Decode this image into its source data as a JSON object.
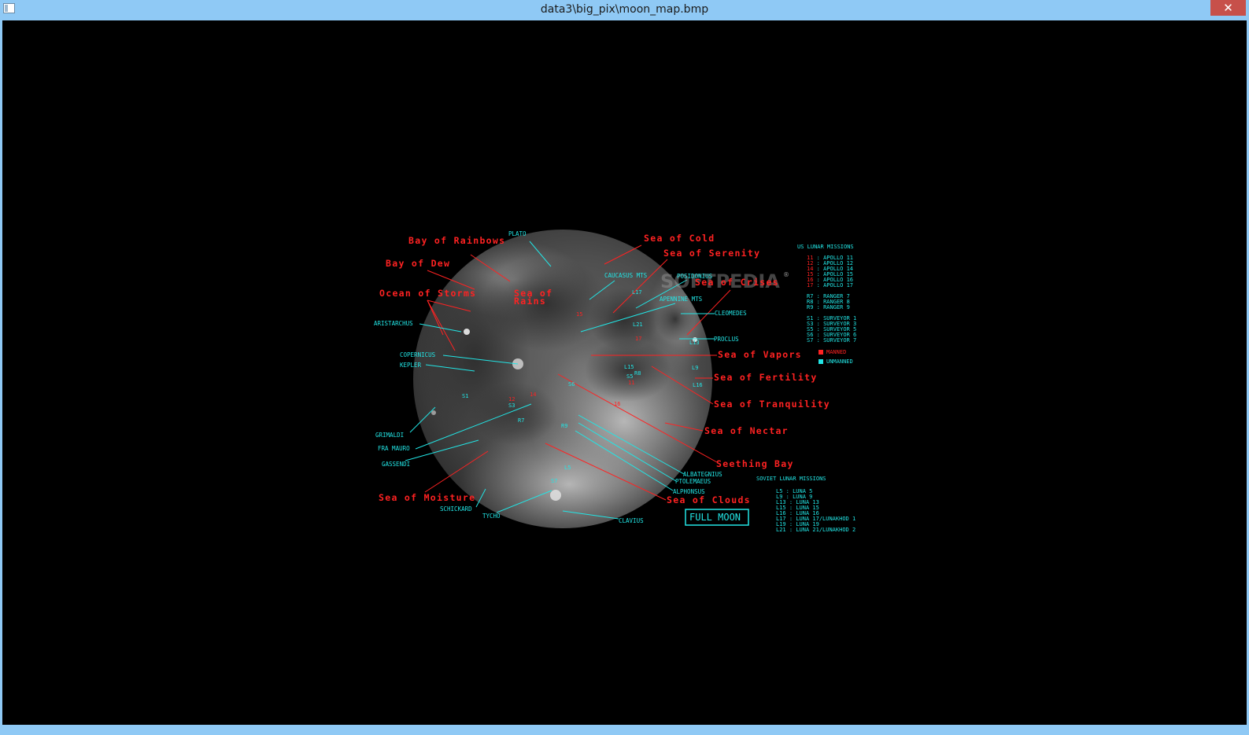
{
  "window": {
    "title": "data3\\big_pix\\moon_map.bmp",
    "close_glyph": "✕"
  },
  "watermark": "SOFTPEDIA",
  "watermark_reg": "®",
  "full_moon_button": "FULL MOON",
  "maria_labels": [
    {
      "id": "bay-of-rainbows",
      "text": "Bay of Rainbows"
    },
    {
      "id": "sea-of-cold",
      "text": "Sea of Cold"
    },
    {
      "id": "sea-of-serenity",
      "text": "Sea of Serenity"
    },
    {
      "id": "bay-of-dew",
      "text": "Bay of Dew"
    },
    {
      "id": "sea-of-crises",
      "text": "Sea of Crises"
    },
    {
      "id": "ocean-of-storms",
      "text": "Ocean of Storms"
    },
    {
      "id": "sea-of-rains-1",
      "text": "Sea of"
    },
    {
      "id": "sea-of-rains-2",
      "text": "Rains"
    },
    {
      "id": "sea-of-vapors",
      "text": "Sea of Vapors"
    },
    {
      "id": "sea-of-fertility",
      "text": "Sea of Fertility"
    },
    {
      "id": "sea-of-tranquility",
      "text": "Sea of Tranquility"
    },
    {
      "id": "sea-of-nectar",
      "text": "Sea of Nectar"
    },
    {
      "id": "seething-bay",
      "text": "Seething Bay"
    },
    {
      "id": "sea-of-moisture",
      "text": "Sea of Moisture"
    },
    {
      "id": "sea-of-clouds",
      "text": "Sea of Clouds"
    }
  ],
  "feature_labels": [
    {
      "id": "plato",
      "text": "PLATO"
    },
    {
      "id": "caucasus-mts",
      "text": "CAUCASUS MTS"
    },
    {
      "id": "posidonius",
      "text": "POSIDONIUS"
    },
    {
      "id": "apennine-mts",
      "text": "APENNINE MTS"
    },
    {
      "id": "cleomedes",
      "text": "CLEOMEDES"
    },
    {
      "id": "aristarchus",
      "text": "ARISTARCHUS"
    },
    {
      "id": "proclus",
      "text": "PROCLUS"
    },
    {
      "id": "copernicus",
      "text": "COPERNICUS"
    },
    {
      "id": "kepler",
      "text": "KEPLER"
    },
    {
      "id": "grimaldi",
      "text": "GRIMALDI"
    },
    {
      "id": "fra-mauro",
      "text": "FRA MAURO"
    },
    {
      "id": "gassendi",
      "text": "GASSENDI"
    },
    {
      "id": "albategnius",
      "text": "ALBATEGNIUS"
    },
    {
      "id": "ptolemaeus",
      "text": "PTOLEMAEUS"
    },
    {
      "id": "alphonsus",
      "text": "ALPHONSUS"
    },
    {
      "id": "schickard",
      "text": "SCHICKARD"
    },
    {
      "id": "tycho",
      "text": "TYCHO"
    },
    {
      "id": "clavius",
      "text": "CLAVIUS"
    }
  ],
  "site_markers": [
    {
      "text": "L17",
      "color": "cyan"
    },
    {
      "text": "15",
      "color": "red"
    },
    {
      "text": "L21",
      "color": "cyan"
    },
    {
      "text": "17",
      "color": "red"
    },
    {
      "text": "L13",
      "color": "cyan"
    },
    {
      "text": "L15",
      "color": "cyan"
    },
    {
      "text": "R8",
      "color": "cyan"
    },
    {
      "text": "L9",
      "color": "cyan"
    },
    {
      "text": "S5",
      "color": "cyan"
    },
    {
      "text": "11",
      "color": "red"
    },
    {
      "text": "L16",
      "color": "cyan"
    },
    {
      "text": "S6",
      "color": "cyan"
    },
    {
      "text": "16",
      "color": "red"
    },
    {
      "text": "S1",
      "color": "cyan"
    },
    {
      "text": "12",
      "color": "red"
    },
    {
      "text": "14",
      "color": "red"
    },
    {
      "text": "S3",
      "color": "cyan"
    },
    {
      "text": "R7",
      "color": "cyan"
    },
    {
      "text": "R9",
      "color": "cyan"
    },
    {
      "text": "L5",
      "color": "cyan"
    },
    {
      "text": "S7",
      "color": "cyan"
    }
  ],
  "us_missions": {
    "title": "US LUNAR MISSIONS",
    "items": [
      {
        "code": "11",
        "sep": " : ",
        "name": "APOLLO 11",
        "code_color": "red"
      },
      {
        "code": "12",
        "sep": " : ",
        "name": "APOLLO 12",
        "code_color": "red"
      },
      {
        "code": "14",
        "sep": " : ",
        "name": "APOLLO 14",
        "code_color": "red"
      },
      {
        "code": "15",
        "sep": " : ",
        "name": "APOLLO 15",
        "code_color": "red"
      },
      {
        "code": "16",
        "sep": " : ",
        "name": "APOLLO 16",
        "code_color": "red"
      },
      {
        "code": "17",
        "sep": " : ",
        "name": "APOLLO 17",
        "code_color": "red"
      },
      {
        "code": "R7",
        "sep": " : ",
        "name": "RANGER 7",
        "code_color": "cyan"
      },
      {
        "code": "R8",
        "sep": " : ",
        "name": "RANGER 8",
        "code_color": "cyan"
      },
      {
        "code": "R9",
        "sep": " : ",
        "name": "RANGER 9",
        "code_color": "cyan"
      },
      {
        "code": "S1",
        "sep": " : ",
        "name": "SURVEYOR 1",
        "code_color": "cyan"
      },
      {
        "code": "S3",
        "sep": " : ",
        "name": "SURVEYOR 3",
        "code_color": "cyan"
      },
      {
        "code": "S5",
        "sep": " : ",
        "name": "SURVEYOR 5",
        "code_color": "cyan"
      },
      {
        "code": "S6",
        "sep": " : ",
        "name": "SURVEYOR 6",
        "code_color": "cyan"
      },
      {
        "code": "S7",
        "sep": " : ",
        "name": "SURVEYOR 7",
        "code_color": "cyan"
      }
    ],
    "legend": [
      {
        "label": "MANNED",
        "color": "#ff2222"
      },
      {
        "label": "UNMANNED",
        "color": "#22e5e5"
      }
    ]
  },
  "soviet_missions": {
    "title": "SOVIET LUNAR MISSIONS",
    "items": [
      {
        "code": "L5",
        "sep": " : ",
        "name": "LUNA 5"
      },
      {
        "code": "L9",
        "sep": " : ",
        "name": "LUNA 9"
      },
      {
        "code": "L13",
        "sep": " : ",
        "name": "LUNA 13"
      },
      {
        "code": "L15",
        "sep": " : ",
        "name": "LUNA 15"
      },
      {
        "code": "L16",
        "sep": " : ",
        "name": "LUNA 16"
      },
      {
        "code": "L17",
        "sep": " : ",
        "name": "LUNA 17/LUNAKHOD 1"
      },
      {
        "code": "L19",
        "sep": " : ",
        "name": "LUNA 19"
      },
      {
        "code": "L21",
        "sep": " : ",
        "name": "LUNA 21/LUNAKHOD 2"
      }
    ]
  },
  "colors": {
    "red": "#ff2222",
    "cyan": "#22e5e5",
    "background": "#000000",
    "titlebar": "#8fc9f5",
    "close": "#c7504a"
  }
}
